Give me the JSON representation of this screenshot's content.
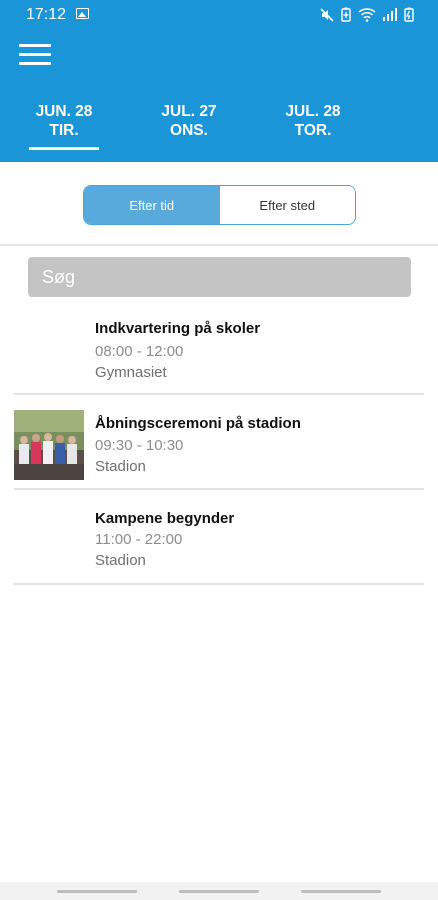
{
  "status_bar": {
    "time": "17:12"
  },
  "tabs": [
    {
      "line1": "JUN. 28",
      "line2": "TIR."
    },
    {
      "line1": "JUL. 27",
      "line2": "ONS."
    },
    {
      "line1": "JUL. 28",
      "line2": "TOR."
    }
  ],
  "filter": {
    "active_label": "Efter tid",
    "inactive_label": "Efter sted"
  },
  "search": {
    "placeholder": "Søg"
  },
  "events": [
    {
      "title": "Indkvartering på skoler",
      "time": "08:00 - 12:00",
      "place": "Gymnasiet"
    },
    {
      "title": "Åbningsceremoni på stadion",
      "time": "09:30 - 10:30",
      "place": "Stadion"
    },
    {
      "title": "Kampene begynder",
      "time": "11:00 - 22:00",
      "place": "Stadion"
    }
  ],
  "colors": {
    "primary": "#1a95d8",
    "segment_active": "#58a9dc",
    "search_bg": "#c4c4c4"
  },
  "icons": [
    "menu-icon",
    "gallery-icon",
    "mute-icon",
    "battery-saver-icon",
    "wifi-icon",
    "signal-icon",
    "battery-icon"
  ]
}
